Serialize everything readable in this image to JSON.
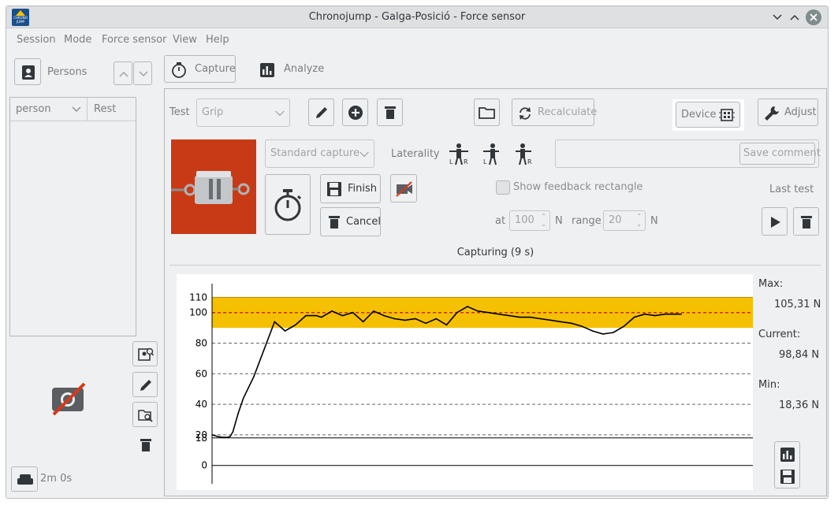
{
  "window": {
    "title": "Chronojump - Galga-Posició - Force sensor",
    "logo_text": "CHRONO JUMP"
  },
  "menu": [
    "Session",
    "Mode",
    "Force sensor",
    "View",
    "Help"
  ],
  "persons": {
    "button_label": "Persons",
    "columns": [
      "person",
      "Rest"
    ],
    "rest_time": "2m 0s"
  },
  "tabs": {
    "capture": "Capture",
    "analyze": "Analyze"
  },
  "toolbar": {
    "test_label": "Test",
    "test_value": "Grip",
    "recalculate": "Recalculate",
    "device": "Device",
    "adjust": "Adjust"
  },
  "capture": {
    "mode_value": "Standard capture",
    "laterality_label": "Laterality",
    "comment_placeholder": "",
    "save_comment": "Save comment",
    "finish": "Finish",
    "cancel": "Cancel",
    "feedback_checkbox": "Show feedback rectangle",
    "feedback_checked": false,
    "at_label": "at",
    "at_value": "100",
    "at_unit": "N",
    "range_label": "range",
    "range_value": "20",
    "range_unit": "N",
    "last_test": "Last test",
    "status": "Capturing (9 s)"
  },
  "stats": {
    "max_label": "Max:",
    "max_value": "105,31 N",
    "current_label": "Current:",
    "current_value": "98,84 N",
    "min_label": "Min:",
    "min_value": "18,36 N"
  },
  "colors": {
    "feedback_band": "#f5c000",
    "target_line": "#cc2a12",
    "accent": "#3daee9"
  },
  "chart_data": {
    "type": "line",
    "title": "",
    "xlabel": "",
    "ylabel": "",
    "ylim": [
      -12,
      121
    ],
    "y_ticks": [
      "0",
      "18",
      "20",
      "40",
      "60",
      "80",
      "100",
      "110"
    ],
    "feedback_band": [
      90,
      110
    ],
    "target": 100,
    "min_line": 18,
    "series": [
      {
        "x": [
          0,
          0.1,
          0.2,
          0.3,
          0.35,
          0.4,
          0.5,
          0.6,
          0.8,
          1.0,
          1.2,
          1.4,
          1.6,
          1.8,
          2.0,
          2.1,
          2.2,
          2.3,
          2.5,
          2.7,
          2.9,
          3.1,
          3.3,
          3.5,
          3.7,
          3.9,
          4.1,
          4.3,
          4.5,
          4.7,
          4.9,
          5.1,
          5.3,
          5.5,
          5.7,
          5.9,
          6.1,
          6.3,
          6.5,
          6.7,
          6.9,
          7.1,
          7.3,
          7.5,
          7.7,
          7.9,
          8.1,
          8.3,
          8.5,
          8.7,
          8.9,
          9.0
        ],
        "y": [
          20,
          19,
          18.4,
          18.4,
          19,
          22,
          34,
          44,
          58,
          76,
          94,
          88,
          92,
          98,
          98,
          97,
          99,
          101,
          98,
          100,
          94,
          101,
          98,
          96,
          95,
          96,
          93,
          96,
          92,
          100,
          104,
          101,
          100,
          99,
          98,
          97,
          97,
          96,
          95,
          94,
          93,
          91,
          88,
          86,
          87,
          91,
          97,
          99,
          98,
          99,
          99,
          99
        ]
      }
    ]
  }
}
